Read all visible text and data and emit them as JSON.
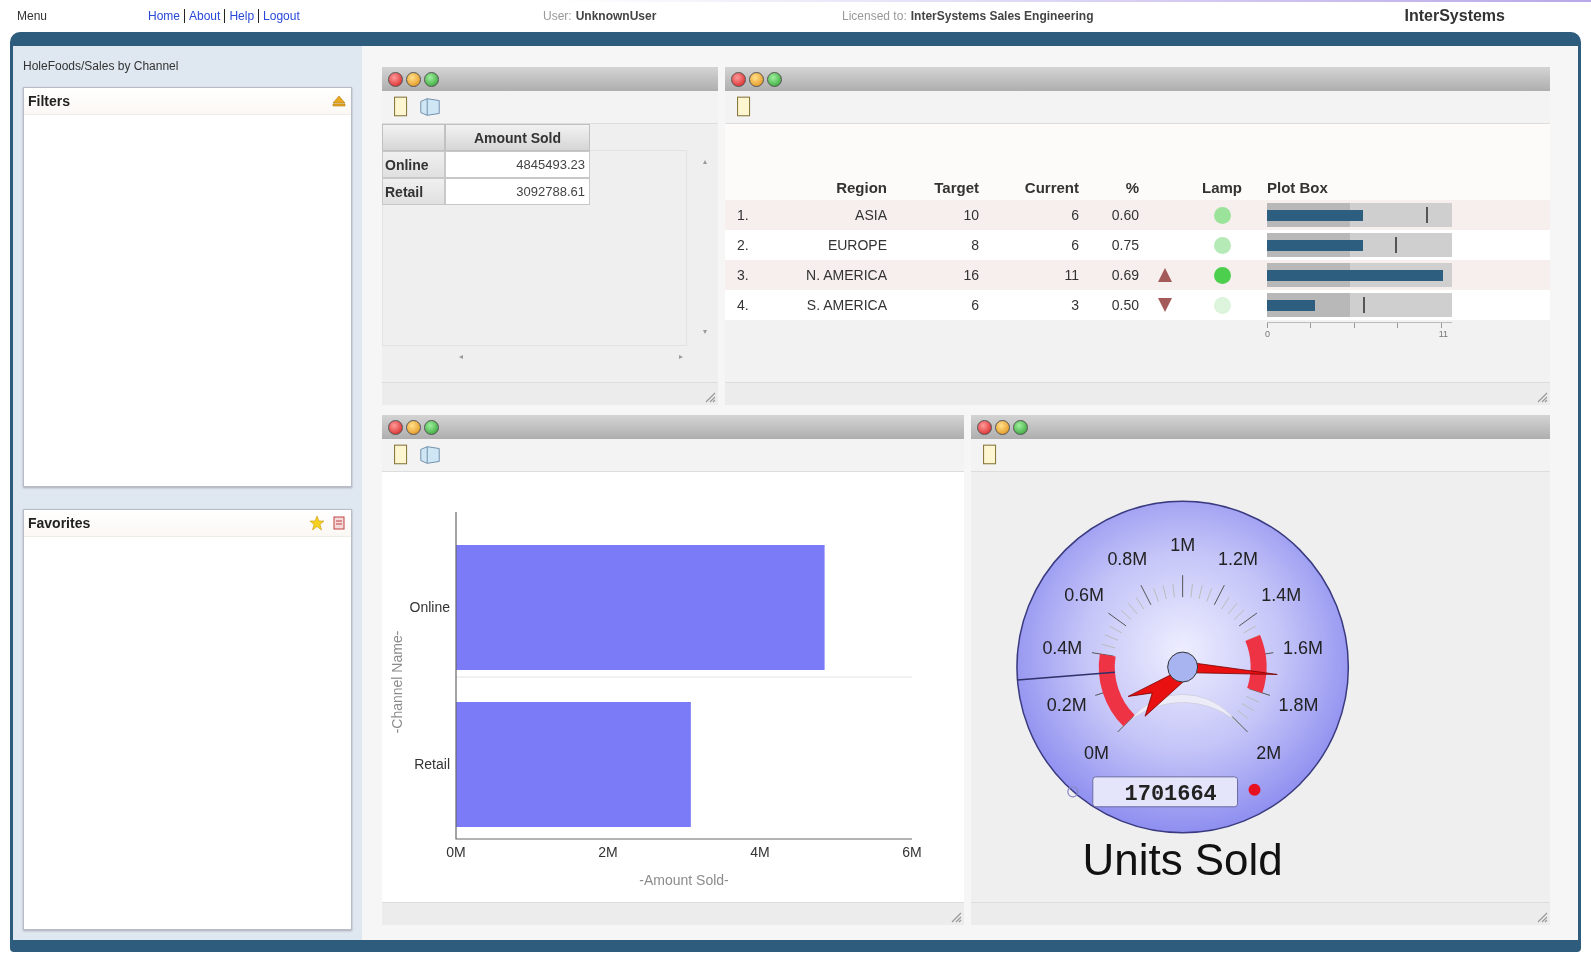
{
  "header": {
    "menu": "Menu",
    "links": [
      "Home",
      "About",
      "Help",
      "Logout"
    ],
    "user_label": "User:",
    "user": "UnknownUser",
    "license_label": "Licensed to:",
    "licensee": "InterSystems Sales Engineering",
    "brand": "InterSystems"
  },
  "sidebar": {
    "title": "HoleFoods/Sales by Channel",
    "filters": {
      "title": "Filters"
    },
    "favorites": {
      "title": "Favorites"
    }
  },
  "pivot": {
    "tools": [
      {
        "kind": "document"
      },
      {
        "kind": "cube"
      }
    ],
    "column": "Amount Sold",
    "rows": [
      {
        "label": "Online",
        "value": "4845493.23"
      },
      {
        "label": "Retail",
        "value": "3092788.61"
      }
    ]
  },
  "scorecard": {
    "tools": [
      {
        "kind": "document"
      }
    ],
    "columns": [
      "Region",
      "Target",
      "Current",
      "%",
      "Lamp",
      "Plot Box"
    ],
    "rows": [
      {
        "index": "1.",
        "region": "ASIA",
        "target": "10",
        "current": "6",
        "percent": "0.60",
        "trend_up": false,
        "trend_down": false,
        "color": "#9be39b",
        "bar": {
          "level": 0.52
        },
        "target_mark": {
          "level": 0.86
        }
      },
      {
        "index": "2.",
        "region": "EUROPE",
        "target": "8",
        "current": "6",
        "percent": "0.75",
        "trend_up": false,
        "trend_down": false,
        "color": "#b5e9b5",
        "bar": {
          "level": 0.52
        },
        "target_mark": {
          "level": 0.69
        }
      },
      {
        "index": "3.",
        "region": "N. AMERICA",
        "target": "16",
        "current": "11",
        "percent": "0.69",
        "trend_up": true,
        "trend_down": false,
        "color": "#4ccf4c",
        "bar": {
          "level": 0.95
        }
      },
      {
        "index": "4.",
        "region": "S. AMERICA",
        "target": "6",
        "current": "3",
        "percent": "0.50",
        "trend_up": false,
        "trend_down": true,
        "color": "#dcf3dc",
        "bar": {
          "level": 0.26
        },
        "target_mark": {
          "level": 0.52
        }
      }
    ],
    "axis": {
      "min_label": "0",
      "max_label": "11"
    }
  },
  "bar_chart": {
    "tools": [
      {
        "kind": "document"
      },
      {
        "kind": "cube"
      }
    ],
    "chart_data": {
      "type": "bar",
      "orientation": "horizontal",
      "xlabel": "-Amount Sold-",
      "ylabel": "-Channel Name-",
      "categories": [
        "Online",
        "Retail"
      ],
      "series": [
        {
          "color": "#7b7bf7",
          "values": [
            4850000,
            3090000
          ]
        }
      ],
      "xlim": [
        0,
        6000000
      ],
      "xticks": [
        {
          "value": 0,
          "label": "0M"
        },
        {
          "value": 2000000,
          "label": "2M"
        },
        {
          "value": 4000000,
          "label": "4M"
        },
        {
          "value": 6000000,
          "label": "6M"
        }
      ]
    }
  },
  "gauge": {
    "tools": [
      {
        "kind": "document"
      }
    ],
    "tick_labels": [
      "0M",
      "0.2M",
      "0.4M",
      "0.6M",
      "0.8M",
      "1M",
      "1.2M",
      "1.4M",
      "1.6M",
      "1.8M",
      "2M"
    ],
    "value": "1701664",
    "title": "Units Sold"
  }
}
